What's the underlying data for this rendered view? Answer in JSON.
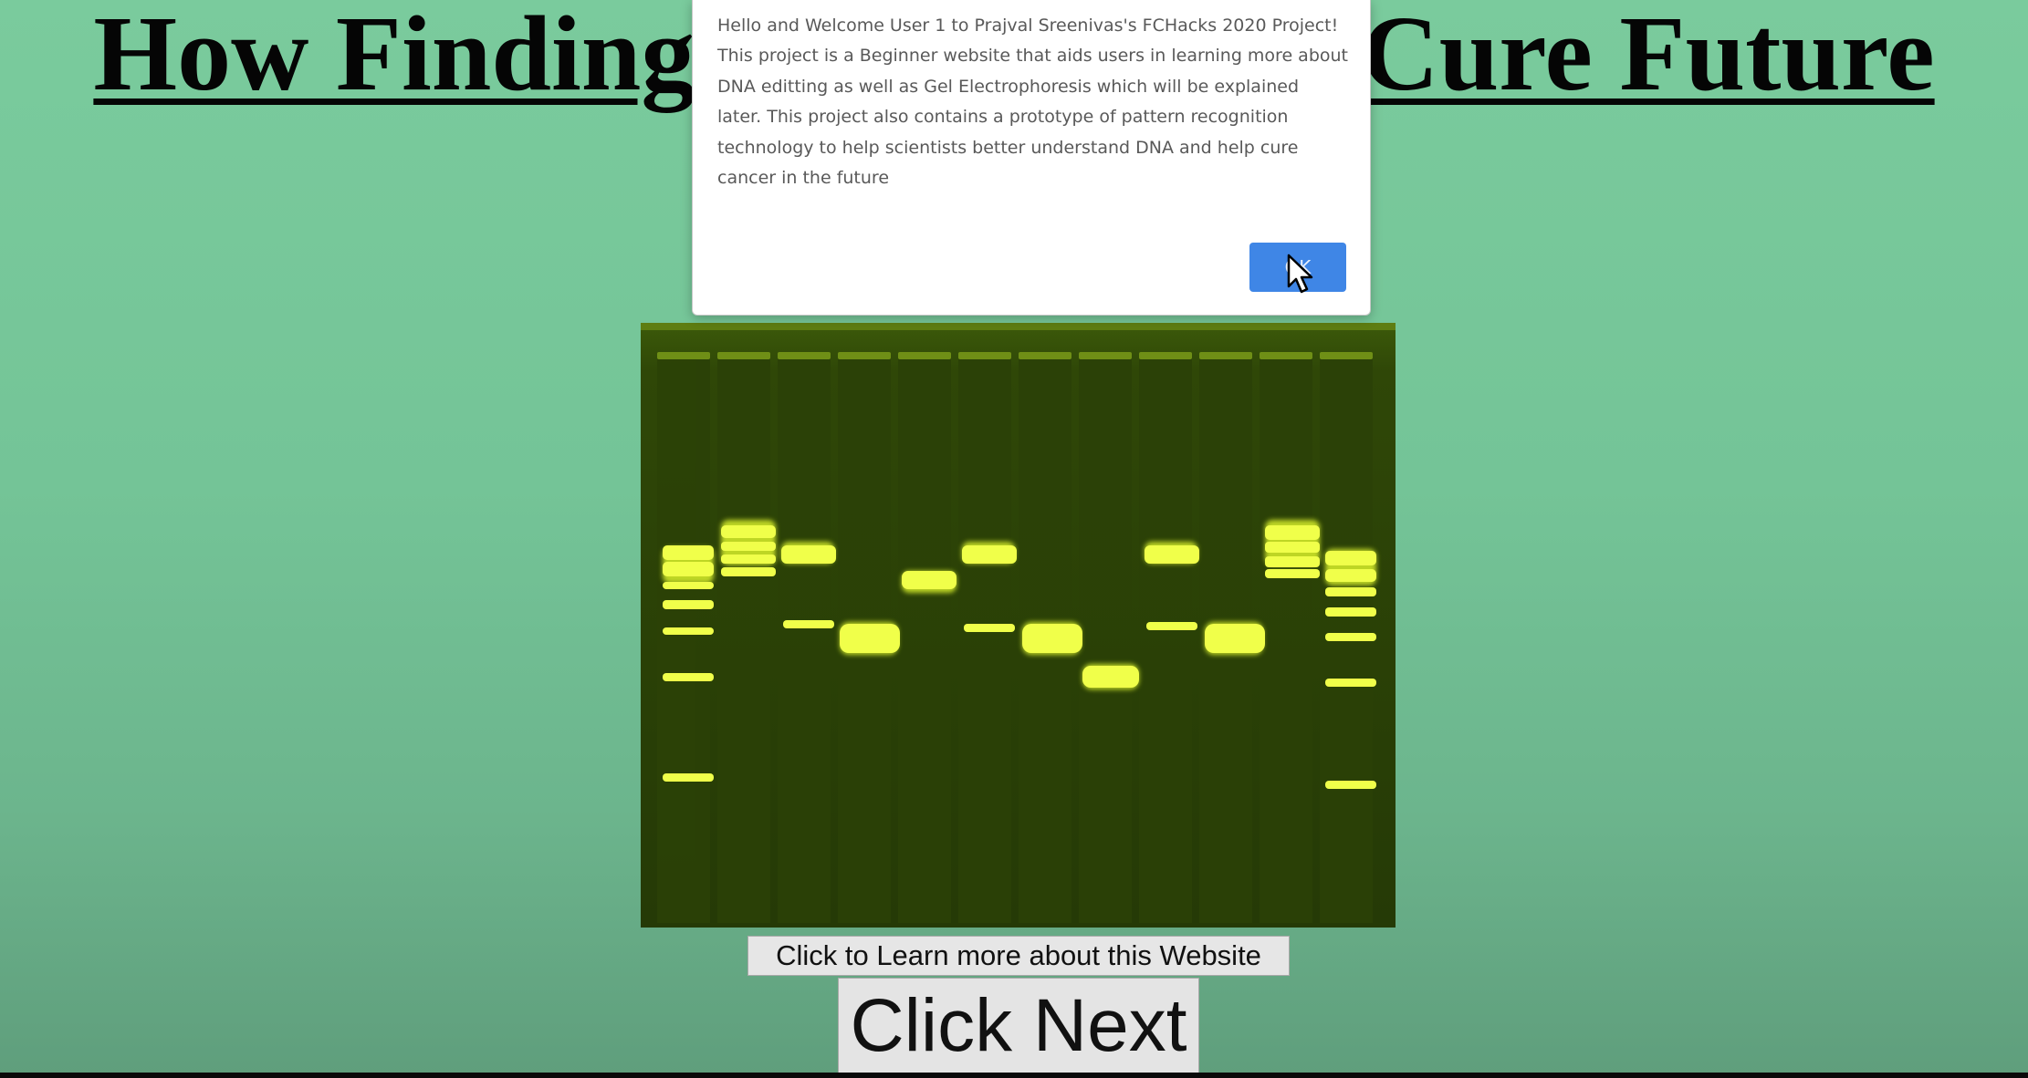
{
  "title": {
    "left_text": "How Finding",
    "right_text": "Cure Future"
  },
  "alert": {
    "message": "Hello and Welcome User 1 to Prajval Sreenivas's FCHacks 2020 Project!\nThis project is a Beginner website that aids users in learning more about\nDNA editting as well as Gel Electrophoresis which will be explained\nlater. This project also contains a prototype of pattern recognition\ntechnology to help scientists better understand DNA and help cure\ncancer in the future",
    "ok_label": "OK"
  },
  "buttons": {
    "learn_more": "Click to Learn more about this Website",
    "next": "Click Next"
  },
  "colors": {
    "background": "#78c89a",
    "gel": "#2c3d06",
    "band": "#e6ff3a",
    "ok_button": "#3f86e6"
  },
  "icons": {
    "cursor": "mouse-pointer-icon"
  }
}
